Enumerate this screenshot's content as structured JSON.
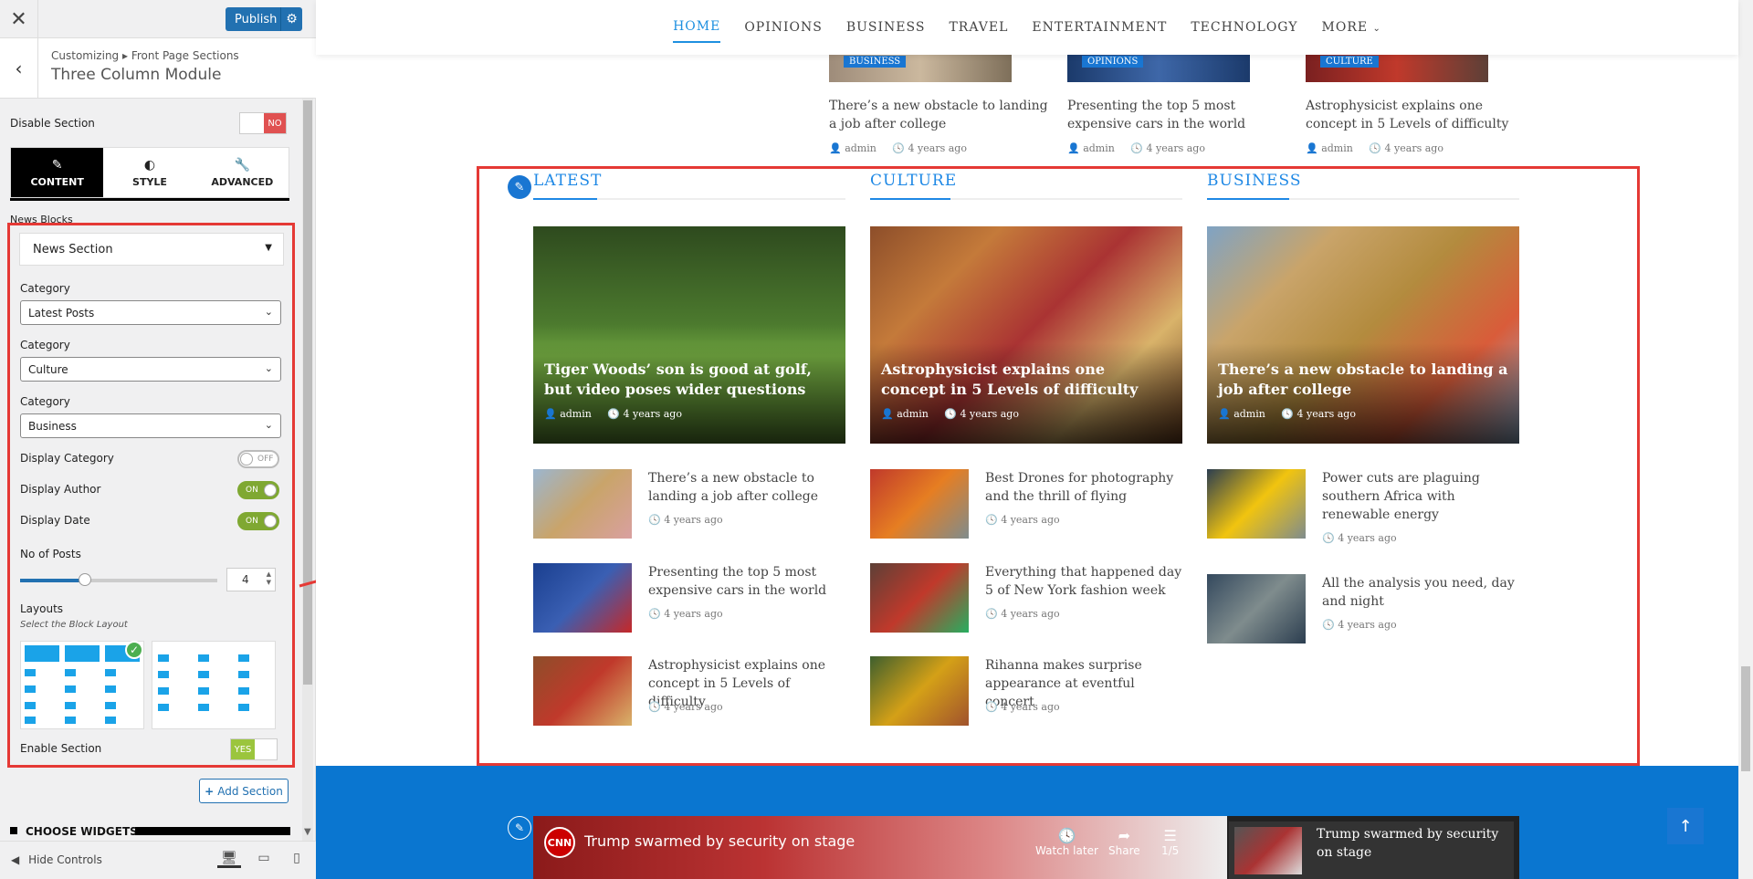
{
  "customizer": {
    "publish_label": "Publish",
    "breadcrumb": "Customizing ▸ Front Page Sections",
    "panel_title": "Three Column Module",
    "disable_section_label": "Disable Section",
    "disable_section_value": "NO",
    "tabs": [
      {
        "label": "CONTENT",
        "icon": "edit-icon",
        "glyph": "✎"
      },
      {
        "label": "STYLE",
        "icon": "palette-icon",
        "glyph": "◐"
      },
      {
        "label": "ADVANCED",
        "icon": "wrench-icon",
        "glyph": "🔧"
      }
    ],
    "news_blocks_label": "News Blocks",
    "news_section_label": "News Section",
    "category_label": "Category",
    "categories": [
      "Latest Posts",
      "Culture",
      "Business"
    ],
    "display_category_label": "Display Category",
    "display_category_value": "OFF",
    "display_author_label": "Display Author",
    "display_author_value": "ON",
    "display_date_label": "Display Date",
    "display_date_value": "ON",
    "no_of_posts_label": "No of Posts",
    "no_of_posts_value": "4",
    "layouts_label": "Layouts",
    "layouts_hint": "Select the Block Layout",
    "enable_section_label": "Enable Section",
    "enable_section_value": "YES",
    "add_section_label": "Add Section",
    "choose_widgets_label": "CHOOSE WIDGETS",
    "hide_controls_label": "Hide Controls"
  },
  "nav": {
    "items": [
      "HOME",
      "OPINIONS",
      "BUSINESS",
      "TRAVEL",
      "ENTERTAINMENT",
      "TECHNOLOGY",
      "MORE"
    ]
  },
  "top_posts": [
    {
      "badge": "BUSINESS",
      "title1": "There’s a new obstacle to landing",
      "title2": "a job after college",
      "author": "admin",
      "date": "4 years ago"
    },
    {
      "badge": "OPINIONS",
      "title1": "Presenting the top 5 most",
      "title2": "expensive cars in the world",
      "author": "admin",
      "date": "4 years ago"
    },
    {
      "badge": "CULTURE",
      "title1": "Astrophysicist explains one",
      "title2": "concept in 5 Levels of difficulty",
      "author": "admin",
      "date": "4 years ago"
    }
  ],
  "columns": [
    {
      "heading": "LATEST",
      "featured": {
        "title": "Tiger Woods’ son is good at golf, but video poses wider questions",
        "author": "admin",
        "date": "4 years ago"
      },
      "list": [
        {
          "title": "There’s a new obstacle to landing a job after college",
          "date": "4 years ago"
        },
        {
          "title": "Presenting the top 5 most expensive cars in the world",
          "date": "4 years ago"
        },
        {
          "title": "Astrophysicist explains one concept in 5 Levels of difficulty",
          "date": "4 years ago"
        }
      ]
    },
    {
      "heading": "CULTURE",
      "featured": {
        "title": "Astrophysicist explains one concept in 5 Levels of difficulty",
        "author": "admin",
        "date": "4 years ago"
      },
      "list": [
        {
          "title": "Best Drones for photography and the thrill of flying",
          "date": "4 years ago"
        },
        {
          "title": "Everything that happened day 5 of New York fashion week",
          "date": "4 years ago"
        },
        {
          "title": "Rihanna makes surprise appearance at eventful concert",
          "date": "4 years ago"
        }
      ]
    },
    {
      "heading": "BUSINESS",
      "featured": {
        "title": "There’s a new obstacle to landing a job after college",
        "author": "admin",
        "date": "4 years ago"
      },
      "list": [
        {
          "title": "Power cuts are plaguing southern Africa with renewable energy",
          "date": "4 years ago"
        },
        {
          "title": "All the analysis you need, day and night",
          "date": "4 years ago"
        }
      ]
    }
  ],
  "video": {
    "logo": "CNN",
    "title": "Trump swarmed by security on stage",
    "watch_later": "Watch later",
    "share": "Share",
    "count": "1/5",
    "side_title": "Trump swarmed by security on stage"
  }
}
